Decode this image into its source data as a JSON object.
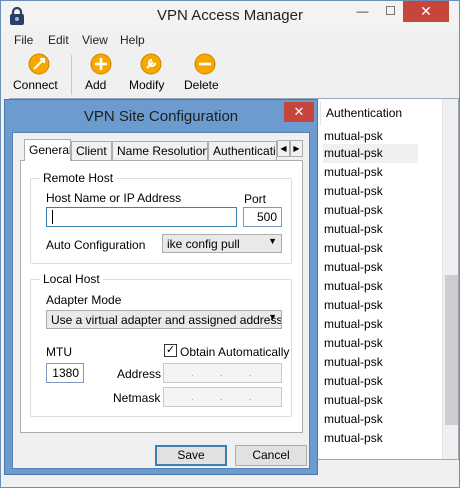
{
  "window": {
    "title": "VPN Access Manager",
    "minimize_glyph": "—",
    "maximize_glyph": "☐",
    "close_glyph": "✕"
  },
  "menu": [
    "File",
    "Edit",
    "View",
    "Help"
  ],
  "toolbar": {
    "connect": "Connect",
    "add": "Add",
    "modify": "Modify",
    "delete": "Delete"
  },
  "list": {
    "header": "Authentication",
    "rows": [
      "mutual-psk",
      "mutual-psk",
      "mutual-psk",
      "mutual-psk",
      "mutual-psk",
      "mutual-psk",
      "mutual-psk",
      "mutual-psk",
      "mutual-psk",
      "mutual-psk",
      "mutual-psk",
      "mutual-psk",
      "mutual-psk",
      "mutual-psk",
      "mutual-psk",
      "mutual-psk",
      "mutual-psk"
    ]
  },
  "dialog": {
    "title": "VPN Site Configuration",
    "close_glyph": "✕",
    "tabs": [
      "General",
      "Client",
      "Name Resolution",
      "Authentication"
    ],
    "remote_host": {
      "group_label": "Remote Host",
      "host_label": "Host Name or IP Address",
      "host_value": "",
      "port_label": "Port",
      "port_value": "500",
      "autoconf_label": "Auto Configuration",
      "autoconf_value": "ike config pull"
    },
    "local_host": {
      "group_label": "Local Host",
      "adapter_label": "Adapter Mode",
      "adapter_value": "Use a virtual adapter and assigned address",
      "mtu_label": "MTU",
      "mtu_value": "1380",
      "obtain_label": "Obtain Automatically",
      "obtain_checked": true,
      "address_label": "Address",
      "netmask_label": "Netmask"
    },
    "save_label": "Save",
    "cancel_label": "Cancel"
  }
}
